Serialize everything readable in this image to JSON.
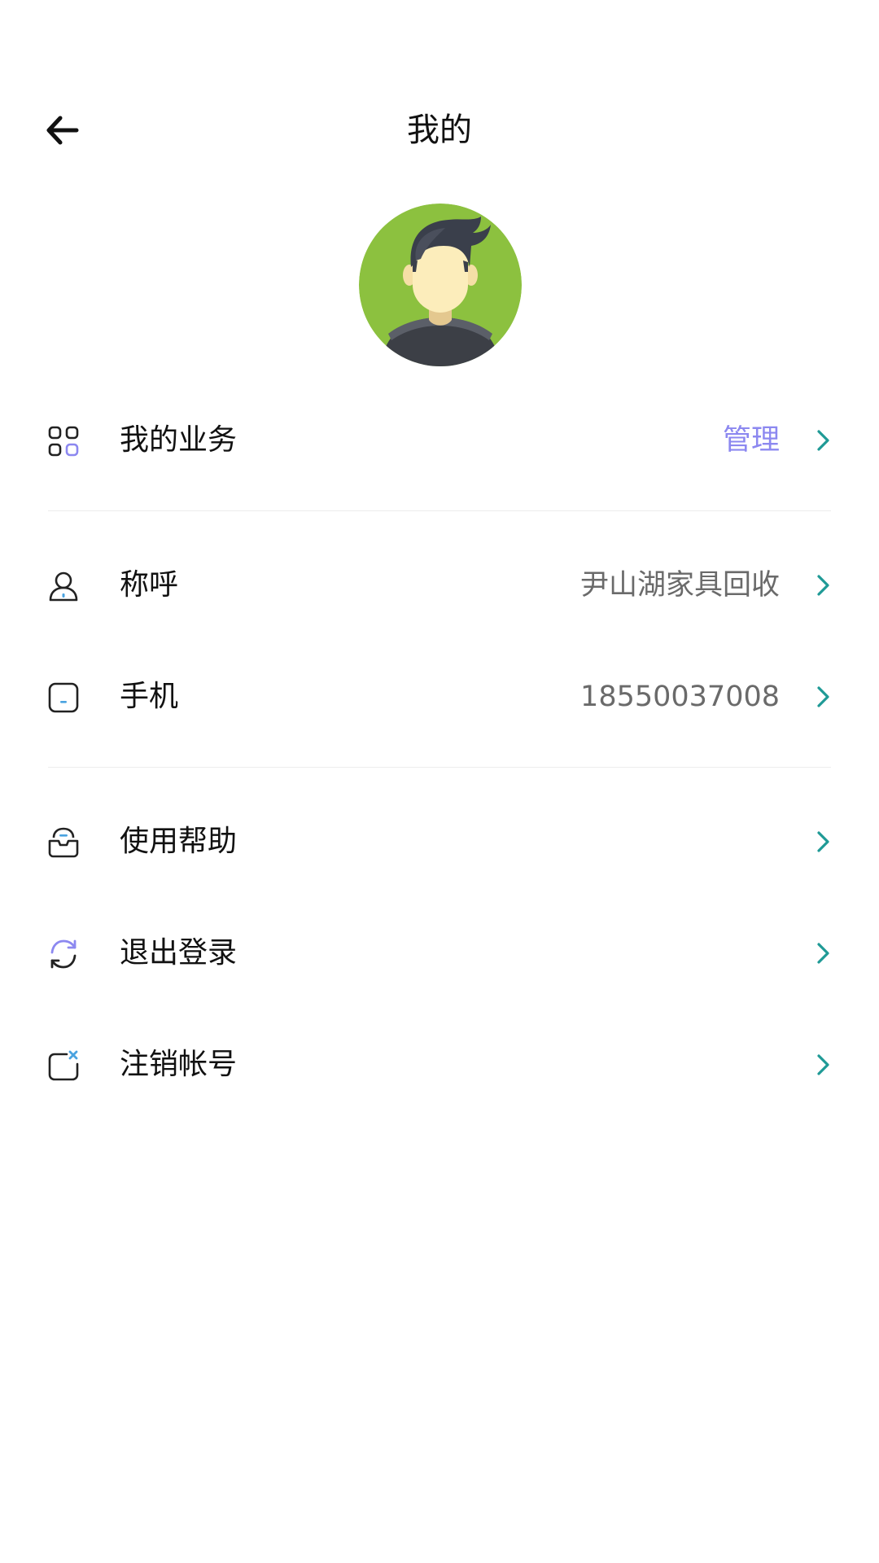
{
  "header": {
    "title": "我的",
    "back_icon": "arrow-left-icon"
  },
  "avatar": {
    "icon": "user-avatar-icon",
    "bg_color": "#8cc13f"
  },
  "menu": {
    "business": {
      "label": "我的业务",
      "value": "管理",
      "icon": "grid-icon"
    },
    "nickname": {
      "label": "称呼",
      "value": "尹山湖家具回收",
      "icon": "user-icon"
    },
    "phone": {
      "label": "手机",
      "value": "18550037008",
      "icon": "phone-icon"
    },
    "help": {
      "label": "使用帮助",
      "icon": "help-inbox-icon"
    },
    "logout": {
      "label": "退出登录",
      "icon": "refresh-icon"
    },
    "deactivate": {
      "label": "注销帐号",
      "icon": "close-account-icon"
    }
  },
  "colors": {
    "accent": "#8c88f0",
    "chevron": "#1f9a96",
    "divider": "#ececec"
  }
}
